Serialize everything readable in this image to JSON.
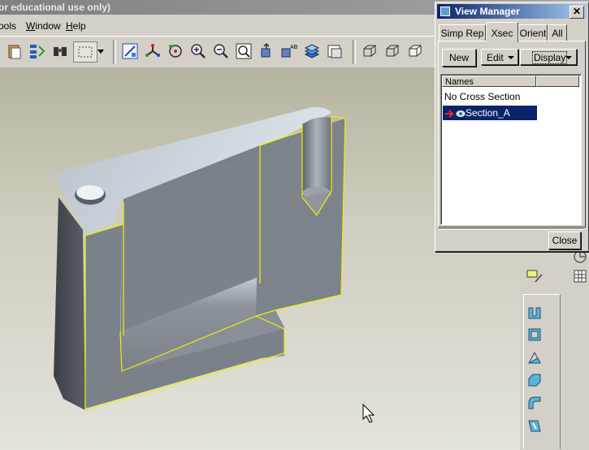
{
  "app": {
    "title_fragment": "or educational use only)"
  },
  "menubar": {
    "items": [
      {
        "label": "ools",
        "underline": ""
      },
      {
        "label": "Window",
        "underline": "W"
      },
      {
        "label": "Help",
        "underline": "H"
      }
    ]
  },
  "view_manager": {
    "title": "View Manager",
    "tabs": [
      "Simp Rep",
      "Xsec",
      "Orient",
      "All"
    ],
    "active_tab": "Xsec",
    "buttons": {
      "new": "New",
      "edit": "Edit",
      "display": "Display"
    },
    "list": {
      "column_header": "Names",
      "rows": [
        "No Cross Section",
        "Section_A"
      ],
      "selected": "Section_A"
    },
    "close_label": "Close"
  },
  "colors": {
    "dialog_title_start": "#0a246a",
    "selection": "#0a246a",
    "edge_highlight": "#f0f000",
    "part_face": "#7a8088"
  }
}
